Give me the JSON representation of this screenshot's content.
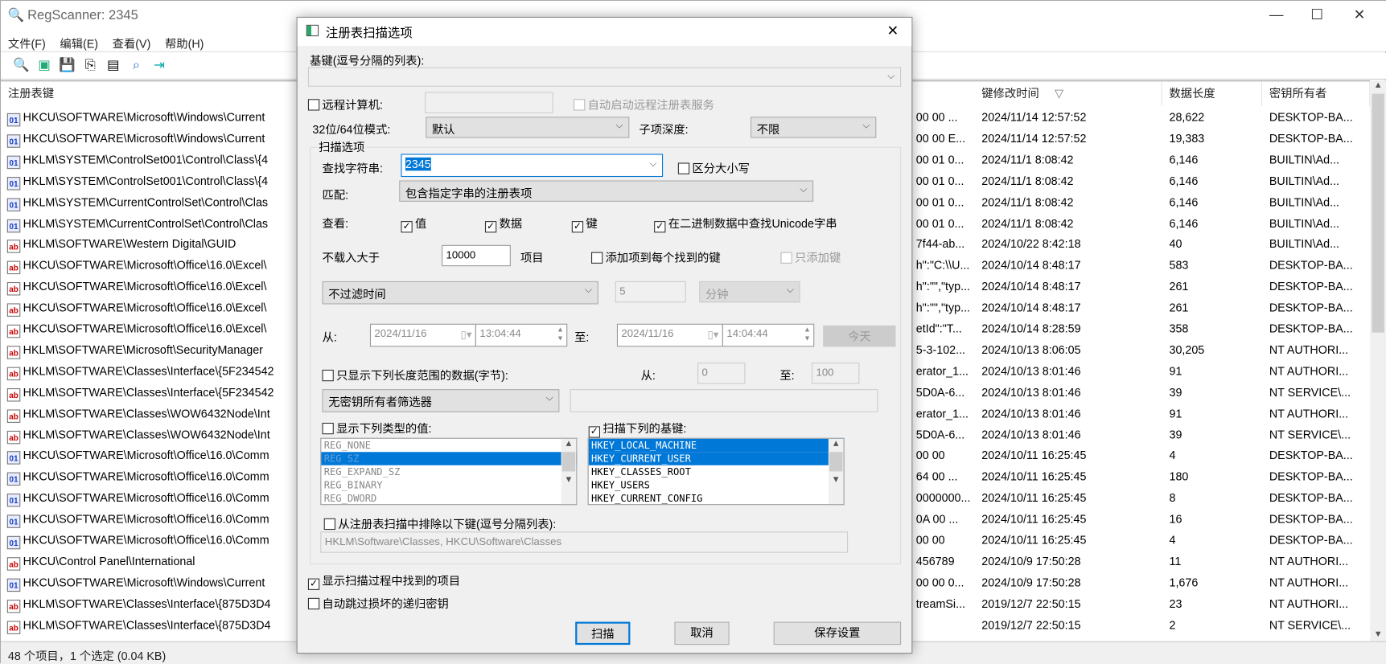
{
  "window": {
    "title": "RegScanner:   2345",
    "minimize": "—",
    "maximize": "☐",
    "close": "✕"
  },
  "menu": [
    "文件(F)",
    "编辑(E)",
    "查看(V)",
    "帮助(H)"
  ],
  "toolbar": [
    "scan-icon",
    "open-icon",
    "save-icon",
    "copy-icon",
    "properties-icon",
    "find-icon",
    "exit-icon"
  ],
  "columns": {
    "key": "注册表键",
    "modified": "键修改时间",
    "sort_indicator": "▽",
    "size": "数据长度",
    "owner": "密钥所有者"
  },
  "rows": [
    {
      "type": "bin",
      "key": "HKCU\\SOFTWARE\\Microsoft\\Windows\\Current",
      "data": "00 00 ...",
      "modified": "2024/11/14 12:57:52",
      "size": "28,622",
      "owner": "DESKTOP-BA..."
    },
    {
      "type": "bin",
      "key": "HKCU\\SOFTWARE\\Microsoft\\Windows\\Current",
      "data": "00 00 E...",
      "modified": "2024/11/14 12:57:52",
      "size": "19,383",
      "owner": "DESKTOP-BA..."
    },
    {
      "type": "bin",
      "key": "HKLM\\SYSTEM\\ControlSet001\\Control\\Class\\{4",
      "data": "00 01 0...",
      "modified": "2024/11/1 8:08:42",
      "size": "6,146",
      "owner": "BUILTIN\\Ad..."
    },
    {
      "type": "bin",
      "key": "HKLM\\SYSTEM\\ControlSet001\\Control\\Class\\{4",
      "data": "00 01 0...",
      "modified": "2024/11/1 8:08:42",
      "size": "6,146",
      "owner": "BUILTIN\\Ad..."
    },
    {
      "type": "bin",
      "key": "HKLM\\SYSTEM\\CurrentControlSet\\Control\\Clas",
      "data": "00 01 0...",
      "modified": "2024/11/1 8:08:42",
      "size": "6,146",
      "owner": "BUILTIN\\Ad..."
    },
    {
      "type": "bin",
      "key": "HKLM\\SYSTEM\\CurrentControlSet\\Control\\Clas",
      "data": "00 01 0...",
      "modified": "2024/11/1 8:08:42",
      "size": "6,146",
      "owner": "BUILTIN\\Ad..."
    },
    {
      "type": "sz",
      "key": "HKLM\\SOFTWARE\\Western Digital\\GUID",
      "data": "7f44-ab...",
      "modified": "2024/10/22 8:42:18",
      "size": "40",
      "owner": "BUILTIN\\Ad..."
    },
    {
      "type": "sz",
      "key": "HKCU\\SOFTWARE\\Microsoft\\Office\\16.0\\Excel\\",
      "data": "h\":\"C:\\\\U...",
      "modified": "2024/10/14 8:48:17",
      "size": "583",
      "owner": "DESKTOP-BA..."
    },
    {
      "type": "sz",
      "key": "HKCU\\SOFTWARE\\Microsoft\\Office\\16.0\\Excel\\",
      "data": "h\":\"\",\"typ...",
      "modified": "2024/10/14 8:48:17",
      "size": "261",
      "owner": "DESKTOP-BA..."
    },
    {
      "type": "sz",
      "key": "HKCU\\SOFTWARE\\Microsoft\\Office\\16.0\\Excel\\",
      "data": "h\":\"\",\"typ...",
      "modified": "2024/10/14 8:48:17",
      "size": "261",
      "owner": "DESKTOP-BA..."
    },
    {
      "type": "sz",
      "key": "HKCU\\SOFTWARE\\Microsoft\\Office\\16.0\\Excel\\",
      "data": "etId\":\"T...",
      "modified": "2024/10/14 8:28:59",
      "size": "358",
      "owner": "DESKTOP-BA..."
    },
    {
      "type": "sz",
      "key": "HKLM\\SOFTWARE\\Microsoft\\SecurityManager",
      "data": "5-3-102...",
      "modified": "2024/10/13 8:06:05",
      "size": "30,205",
      "owner": "NT AUTHORI..."
    },
    {
      "type": "sz",
      "key": "HKLM\\SOFTWARE\\Classes\\Interface\\{5F234542",
      "data": "erator_1...",
      "modified": "2024/10/13 8:01:46",
      "size": "91",
      "owner": "NT AUTHORI..."
    },
    {
      "type": "sz",
      "key": "HKLM\\SOFTWARE\\Classes\\Interface\\{5F234542",
      "data": "5D0A-6...",
      "modified": "2024/10/13 8:01:46",
      "size": "39",
      "owner": "NT SERVICE\\..."
    },
    {
      "type": "sz",
      "key": "HKLM\\SOFTWARE\\Classes\\WOW6432Node\\Int",
      "data": "erator_1...",
      "modified": "2024/10/13 8:01:46",
      "size": "91",
      "owner": "NT AUTHORI..."
    },
    {
      "type": "sz",
      "key": "HKLM\\SOFTWARE\\Classes\\WOW6432Node\\Int",
      "data": "5D0A-6...",
      "modified": "2024/10/13 8:01:46",
      "size": "39",
      "owner": "NT SERVICE\\..."
    },
    {
      "type": "bin",
      "key": "HKCU\\SOFTWARE\\Microsoft\\Office\\16.0\\Comm",
      "data": "00 00",
      "modified": "2024/10/11 16:25:45",
      "size": "4",
      "owner": "DESKTOP-BA..."
    },
    {
      "type": "bin",
      "key": "HKCU\\SOFTWARE\\Microsoft\\Office\\16.0\\Comm",
      "data": "64 00 ...",
      "modified": "2024/10/11 16:25:45",
      "size": "180",
      "owner": "DESKTOP-BA..."
    },
    {
      "type": "bin",
      "key": "HKCU\\SOFTWARE\\Microsoft\\Office\\16.0\\Comm",
      "data": "0000000...",
      "modified": "2024/10/11 16:25:45",
      "size": "8",
      "owner": "DESKTOP-BA..."
    },
    {
      "type": "bin",
      "key": "HKCU\\SOFTWARE\\Microsoft\\Office\\16.0\\Comm",
      "data": "0A 00 ...",
      "modified": "2024/10/11 16:25:45",
      "size": "16",
      "owner": "DESKTOP-BA..."
    },
    {
      "type": "bin",
      "key": "HKCU\\SOFTWARE\\Microsoft\\Office\\16.0\\Comm",
      "data": "00 00",
      "modified": "2024/10/11 16:25:45",
      "size": "4",
      "owner": "DESKTOP-BA..."
    },
    {
      "type": "sz",
      "key": "HKCU\\Control Panel\\International",
      "data": "456789",
      "modified": "2024/10/9 17:50:28",
      "size": "11",
      "owner": "NT AUTHORI..."
    },
    {
      "type": "bin",
      "key": "HKCU\\SOFTWARE\\Microsoft\\Windows\\Current",
      "data": "00 00 0...",
      "modified": "2024/10/9 17:50:28",
      "size": "1,676",
      "owner": "NT AUTHORI..."
    },
    {
      "type": "sz",
      "key": "HKLM\\SOFTWARE\\Classes\\Interface\\{875D3D4",
      "data": "treamSi...",
      "modified": "2019/12/7 22:50:15",
      "size": "23",
      "owner": "NT AUTHORI..."
    },
    {
      "type": "sz",
      "key": "HKLM\\SOFTWARE\\Classes\\Interface\\{875D3D4",
      "data": "",
      "modified": "2019/12/7 22:50:15",
      "size": "2",
      "owner": "NT SERVICE\\..."
    }
  ],
  "status": "48 个项目，1 个选定  (0.04 KB)",
  "dialog": {
    "title": "注册表扫描选项",
    "close": "✕",
    "base_keys_label": "基键(逗号分隔的列表):",
    "base_keys_value": "",
    "remote_label": "远程计算机:",
    "remote_value": "",
    "auto_start_label": "自动启动远程注册表服务",
    "mode_label": "32位/64位模式:",
    "mode_value": "默认",
    "depth_label": "子项深度:",
    "depth_value": "不限",
    "group_label": "扫描选项",
    "find_label": "查找字符串:",
    "find_value": "2345",
    "case_label": "区分大小写",
    "match_label": "匹配:",
    "match_value": "包含指定字串的注册表项",
    "look_label": "查看:",
    "look_values": "值",
    "look_data": "数据",
    "look_keys": "键",
    "look_unicode": "在二进制数据中查找Unicode字串",
    "noload_label": "不载入大于",
    "noload_value": "10000",
    "items_label": "项目",
    "add_items_label": "添加项到每个找到的键",
    "only_keys_label": "只添加键",
    "time_filter": "不过滤时间",
    "time_amount": "5",
    "time_unit": "分钟",
    "from_label": "从:",
    "from_date": "2024/11/16",
    "from_time": "13:04:44",
    "to_label": "至:",
    "to_date": "2024/11/16",
    "to_time": "14:04:44",
    "today": "今天",
    "length_label": "只显示下列长度范围的数据(字节):",
    "len_from_label": "从:",
    "len_from": "0",
    "len_to_label": "至:",
    "len_to": "100",
    "owner_filter": "无密钥所有者筛选器",
    "owner_value": "",
    "types_label": "显示下列类型的值:",
    "types": [
      "REG_NONE",
      "REG_SZ",
      "REG_EXPAND_SZ",
      "REG_BINARY",
      "REG_DWORD"
    ],
    "types_selected": [
      1
    ],
    "scan_keys_label": "扫描下列的基键:",
    "keys": [
      "HKEY_LOCAL_MACHINE",
      "HKEY_CURRENT_USER",
      "HKEY_CLASSES_ROOT",
      "HKEY_USERS",
      "HKEY_CURRENT_CONFIG"
    ],
    "keys_selected": [
      0,
      1
    ],
    "exclude_label": "从注册表扫描中排除以下键(逗号分隔列表):",
    "exclude_value": "HKLM\\Software\\Classes, HKCU\\Software\\Classes",
    "show_found_label": "显示扫描过程中找到的项目",
    "skip_label": "自动跳过损坏的递归密钥",
    "scan_btn": "扫描",
    "cancel_btn": "取消",
    "save_btn": "保存设置",
    "checked": {
      "remote": false,
      "auto_start": false,
      "case": false,
      "values": true,
      "data": true,
      "keys": true,
      "unicode": true,
      "add_items": false,
      "only_keys": false,
      "length": false,
      "types": false,
      "scan_keys": true,
      "exclude": false,
      "show_found": true,
      "skip": false
    }
  },
  "colors": {
    "selection": "#0078d7",
    "binary_icon": "#1a3fc0",
    "string_icon": "#cc0000",
    "dialog_bg": "#f0f0f0"
  }
}
